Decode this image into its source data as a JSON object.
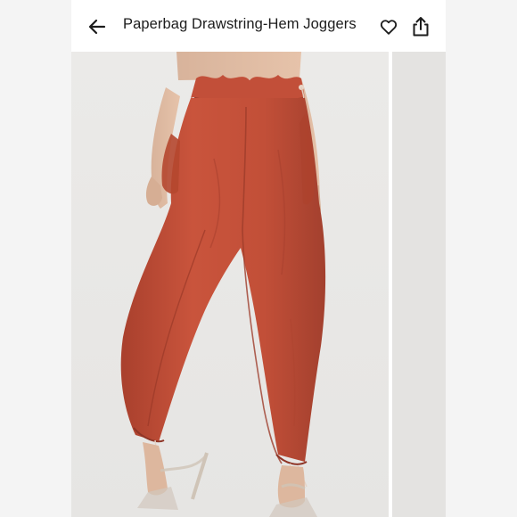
{
  "header": {
    "title": "Paperbag Drawstring-Hem Joggers",
    "back_icon": "arrow-left-icon",
    "like_icon": "heart-outline-icon",
    "share_icon": "share-upload-icon"
  },
  "product": {
    "color": "#c4503a",
    "image_subject": "rust red paperbag waist drawstring-hem joggers with clear heeled sandals"
  },
  "colors": {
    "background": "#f1f1f1",
    "header_bg": "#ffffff",
    "text": "#1c1c1c",
    "photo_bg": "#e8e7e5"
  }
}
